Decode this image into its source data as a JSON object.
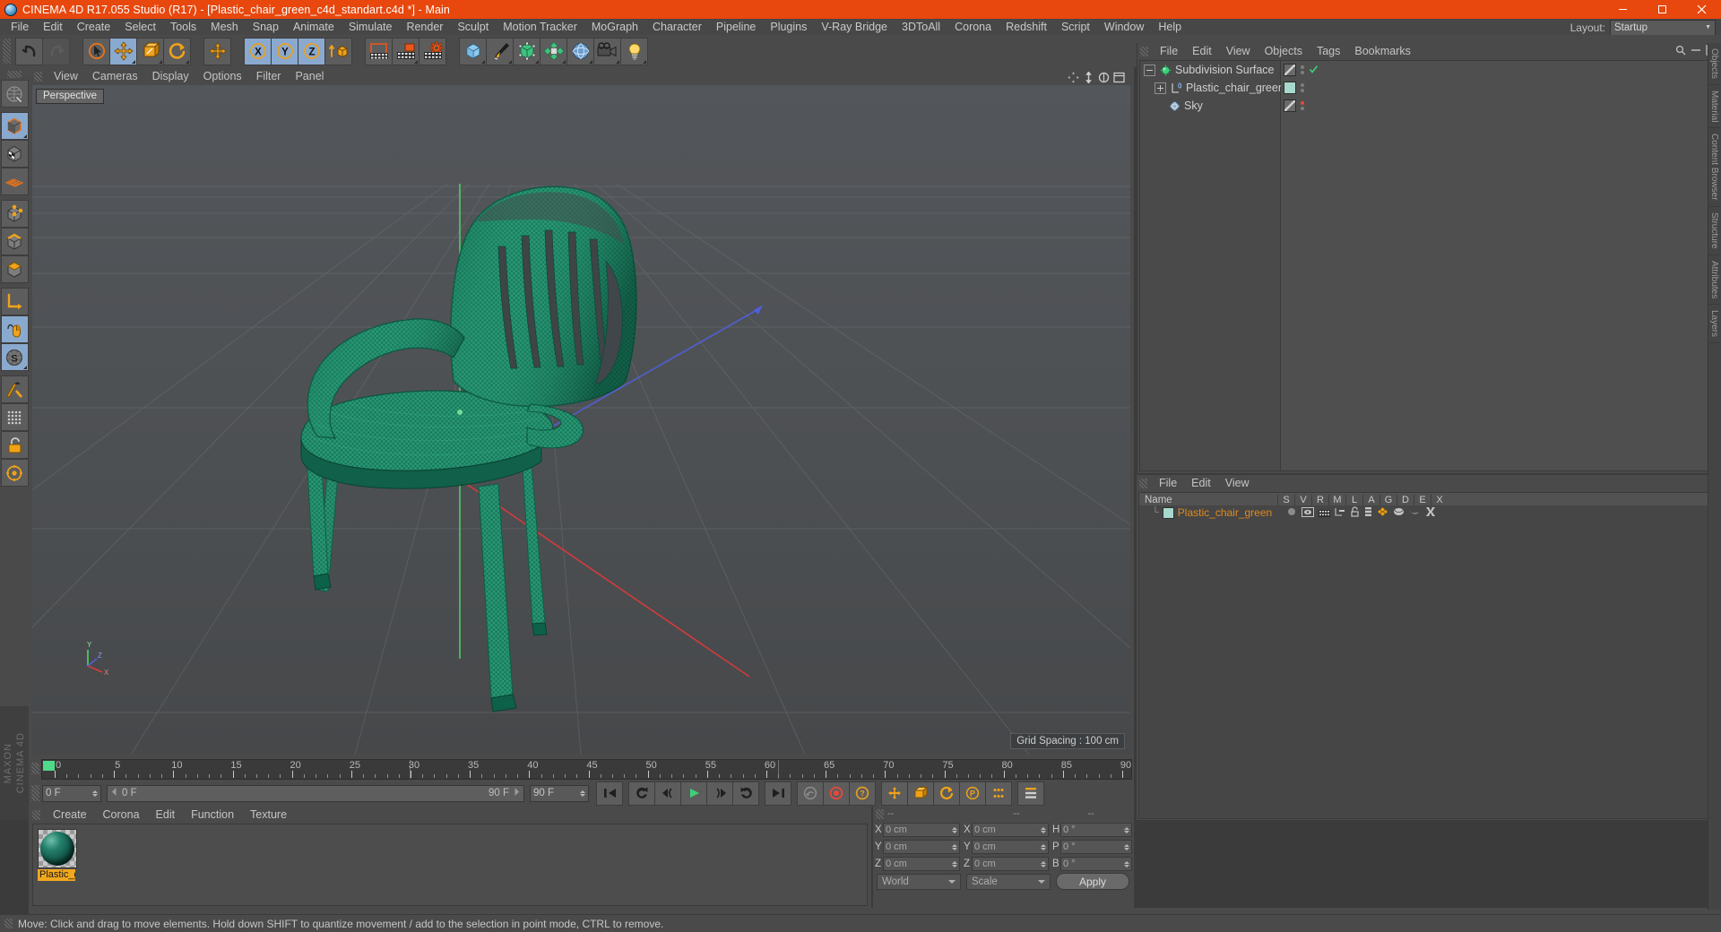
{
  "titlebar": {
    "title": "CINEMA 4D R17.055 Studio (R17) - [Plastic_chair_green_c4d_standart.c4d *] - Main",
    "minimize": "–",
    "maximize": "□",
    "close": "✕"
  },
  "menubar": {
    "items": [
      {
        "label": "File"
      },
      {
        "label": "Edit"
      },
      {
        "label": "Create"
      },
      {
        "label": "Select"
      },
      {
        "label": "Tools"
      },
      {
        "label": "Mesh"
      },
      {
        "label": "Snap"
      },
      {
        "label": "Animate"
      },
      {
        "label": "Simulate"
      },
      {
        "label": "Render"
      },
      {
        "label": "Sculpt"
      },
      {
        "label": "Motion Tracker"
      },
      {
        "label": "MoGraph"
      },
      {
        "label": "Character"
      },
      {
        "label": "Pipeline"
      },
      {
        "label": "Plugins"
      },
      {
        "label": "V-Ray Bridge"
      },
      {
        "label": "3DToAll"
      },
      {
        "label": "Corona"
      },
      {
        "label": "Redshift"
      },
      {
        "label": "Script"
      },
      {
        "label": "Window"
      },
      {
        "label": "Help"
      }
    ],
    "layout_label": "Layout:",
    "layout_value": "Startup"
  },
  "toolbar": {
    "tools": [
      {
        "name": "undo-icon",
        "state": "enabled"
      },
      {
        "name": "redo-icon",
        "state": "disabled"
      },
      {
        "name": "select-live-icon",
        "state": "enabled"
      },
      {
        "name": "move-tool-icon",
        "state": "active"
      },
      {
        "name": "scale-tool-icon",
        "state": "enabled"
      },
      {
        "name": "rotate-tool-icon",
        "state": "enabled"
      },
      {
        "name": "move-axis-icon",
        "state": "enabled"
      },
      {
        "name": "lock-x-axis-icon",
        "state": "active"
      },
      {
        "name": "lock-y-axis-icon",
        "state": "active"
      },
      {
        "name": "lock-z-axis-icon",
        "state": "active"
      },
      {
        "name": "world-object-coordinates-icon",
        "state": "enabled"
      },
      {
        "name": "render-view-icon",
        "state": "enabled"
      },
      {
        "name": "render-picture-viewer-icon",
        "state": "enabled"
      },
      {
        "name": "render-settings-icon",
        "state": "enabled"
      },
      {
        "name": "add-cube-primitive-icon",
        "state": "enabled"
      },
      {
        "name": "add-spline-pen-icon",
        "state": "enabled"
      },
      {
        "name": "add-generator-icon",
        "state": "enabled"
      },
      {
        "name": "add-deformer-icon",
        "state": "enabled"
      },
      {
        "name": "add-environment-icon",
        "state": "enabled"
      },
      {
        "name": "add-camera-icon",
        "state": "enabled"
      },
      {
        "name": "add-light-icon",
        "state": "enabled"
      }
    ]
  },
  "left_tools": [
    {
      "name": "make-editable-icon",
      "state": "enabled"
    },
    {
      "name": "model-mode-icon",
      "state": "active"
    },
    {
      "name": "texture-mode-icon",
      "state": "enabled"
    },
    {
      "name": "uv-polygon-mode-icon",
      "state": "enabled"
    },
    {
      "name": "point-mode-icon",
      "state": "enabled"
    },
    {
      "name": "edge-mode-icon",
      "state": "enabled"
    },
    {
      "name": "polygon-mode-icon",
      "state": "enabled"
    },
    {
      "name": "axis-mode-icon",
      "state": "enabled"
    },
    {
      "name": "enable-snapping-icon",
      "state": "active"
    },
    {
      "name": "workplane-icon",
      "state": "active"
    },
    {
      "name": "viewport-solo-icon",
      "state": "enabled"
    },
    {
      "name": "texture-axis-icon",
      "state": "enabled"
    },
    {
      "name": "lock-workplane-icon",
      "state": "enabled"
    },
    {
      "name": "quantize-icon",
      "state": "enabled"
    }
  ],
  "viewport": {
    "menu": [
      {
        "label": "View"
      },
      {
        "label": "Cameras"
      },
      {
        "label": "Display"
      },
      {
        "label": "Options"
      },
      {
        "label": "Filter"
      },
      {
        "label": "Panel"
      }
    ],
    "tab_label": "Perspective",
    "grid_spacing": "Grid Spacing : 100 cm",
    "axis_x": "X",
    "axis_y": "Y",
    "axis_z": "Z",
    "scene_description": "Green plastic garden chair, wireframe-shaded perspective view",
    "model_color": "#1e8a66",
    "background_color": "#4d5052"
  },
  "object_manager": {
    "menu": [
      {
        "label": "File"
      },
      {
        "label": "Edit"
      },
      {
        "label": "View"
      },
      {
        "label": "Objects"
      },
      {
        "label": "Tags"
      },
      {
        "label": "Bookmarks"
      }
    ],
    "objects": [
      {
        "label": "Subdivision Surface",
        "icon": "subdivision-surface-icon",
        "depth": 0,
        "expander": "minus",
        "tag_swatch": "diagonal",
        "tag_mark": "check",
        "mark_color": "#3fd07a"
      },
      {
        "label": "Plastic_chair_green",
        "icon": "polygon-object-icon",
        "depth": 1,
        "expander": "plus",
        "tag_swatch": "solid",
        "swatch_color": "#a8d8cd",
        "tag_mark": "none"
      },
      {
        "label": "Sky",
        "icon": "sky-object-icon",
        "depth": 1,
        "expander": "none",
        "tag_swatch": "diagonal",
        "tag_mark": "dot",
        "mark_color": "#e8483c"
      }
    ]
  },
  "layer_manager": {
    "menu": [
      {
        "label": "File"
      },
      {
        "label": "Edit"
      },
      {
        "label": "View"
      }
    ],
    "columns": [
      "Name",
      "S",
      "V",
      "R",
      "M",
      "L",
      "A",
      "G",
      "D",
      "E",
      "X"
    ],
    "rows": [
      {
        "name": "Plastic_chair_green",
        "swatch_color": "#a8d8cd",
        "text_color": "#e08a1e"
      }
    ]
  },
  "timeline": {
    "ticks": [
      0,
      5,
      10,
      15,
      20,
      25,
      30,
      35,
      40,
      45,
      50,
      55,
      60,
      65,
      70,
      75,
      80,
      85,
      90
    ],
    "start_marker_frame": 0,
    "current_frame_readout": "0 F"
  },
  "animbar": {
    "current_frame": "0 F",
    "scrub_left": "0 F",
    "scrub_right": "90 F",
    "end_frame": "90 F",
    "buttons": [
      {
        "name": "go-to-start-button",
        "glyph": "⏮"
      },
      {
        "name": "play-backwards-button",
        "glyph": "↺"
      },
      {
        "name": "previous-frame-button",
        "glyph": "◀"
      },
      {
        "name": "play-forward-button",
        "glyph": "▶"
      },
      {
        "name": "next-frame-button",
        "glyph": "▶"
      },
      {
        "name": "play-loop-button",
        "glyph": "↻"
      },
      {
        "name": "go-to-end-button",
        "glyph": "⏭"
      },
      {
        "name": "record-key-button",
        "glyph": "●"
      },
      {
        "name": "autokeying-button",
        "glyph": "●"
      },
      {
        "name": "keyframe-selection-button",
        "glyph": "?"
      },
      {
        "name": "position-key-button",
        "glyph": "✥"
      },
      {
        "name": "rotation-key-button",
        "glyph": "↻"
      },
      {
        "name": "scale-key-button",
        "glyph": "⤢"
      },
      {
        "name": "parameter-key-button",
        "glyph": "P"
      },
      {
        "name": "point-level-animation-button",
        "glyph": "∷"
      },
      {
        "name": "timeline-toggle-button",
        "glyph": "≡"
      }
    ]
  },
  "material_manager": {
    "menu": [
      {
        "label": "Create"
      },
      {
        "label": "Corona"
      },
      {
        "label": "Edit"
      },
      {
        "label": "Function"
      },
      {
        "label": "Texture"
      }
    ],
    "materials": [
      {
        "name": "Plastic_g",
        "full_name": "Plastic_green",
        "color": "#1e8a66",
        "selected": true
      }
    ]
  },
  "coordinates": {
    "header_dashes": [
      "--",
      "--",
      "--"
    ],
    "position": [
      {
        "label": "X",
        "value": "0 cm"
      },
      {
        "label": "Y",
        "value": "0 cm"
      },
      {
        "label": "Z",
        "value": "0 cm"
      }
    ],
    "size": [
      {
        "label": "X",
        "value": "0 cm"
      },
      {
        "label": "Y",
        "value": "0 cm"
      },
      {
        "label": "Z",
        "value": "0 cm"
      }
    ],
    "rotation": [
      {
        "label": "H",
        "value": "0 °"
      },
      {
        "label": "P",
        "value": "0 °"
      },
      {
        "label": "B",
        "value": "0 °"
      }
    ],
    "coord_system": "World",
    "size_mode": "Scale",
    "apply_label": "Apply"
  },
  "status_bar": {
    "message": "Move: Click and drag to move elements. Hold down SHIFT to quantize movement / add to the selection in point mode, CTRL to remove."
  },
  "right_tabs": [
    {
      "label": "Objects"
    },
    {
      "label": "Material"
    },
    {
      "label": "Content Browser"
    },
    {
      "label": "Structure"
    },
    {
      "label": "Attributes"
    },
    {
      "label": "Layers"
    }
  ],
  "branding": {
    "maxon": "MAXON",
    "cinema4d": "CINEMA 4D"
  },
  "colors": {
    "accent_orange": "#e8470d",
    "panel_bg": "#4a4a4a",
    "viewport_bg": "#4d5052",
    "highlight_blue": "#8aa9cf",
    "material_orange": "#f0a81e"
  }
}
